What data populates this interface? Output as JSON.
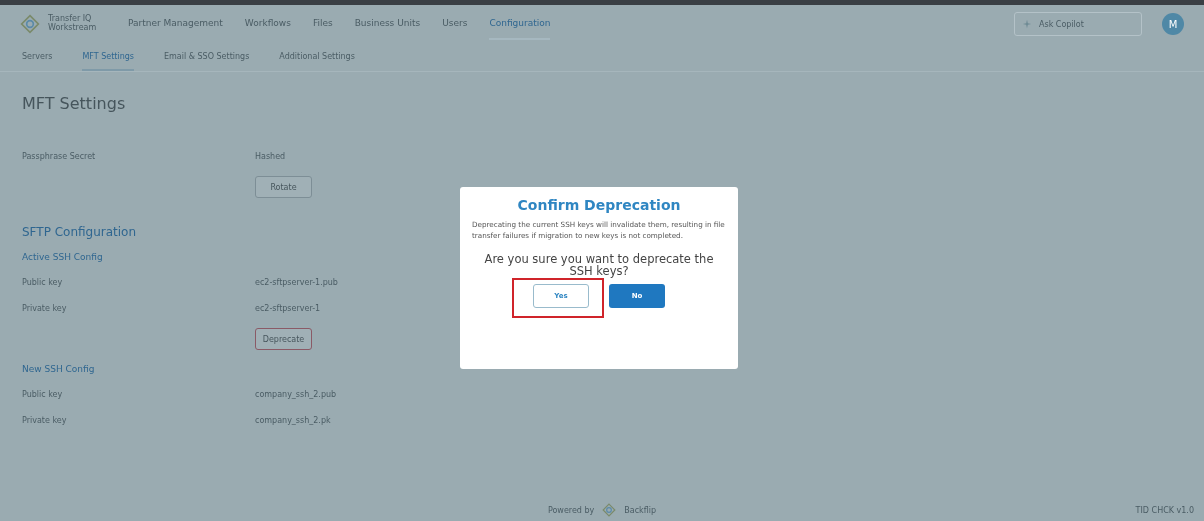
{
  "app": {
    "brand": "Transfer IQ Workstream"
  },
  "nav": [
    {
      "label": "Partner Management",
      "selected": false
    },
    {
      "label": "Workflows",
      "selected": false
    },
    {
      "label": "Files",
      "selected": false
    },
    {
      "label": "Business Units",
      "selected": false
    },
    {
      "label": "Users",
      "selected": false
    },
    {
      "label": "Configuration",
      "selected": true
    }
  ],
  "search": {
    "placeholder": "Ask Copilot"
  },
  "avatar": {
    "initial": "M"
  },
  "subtabs": [
    {
      "label": "Servers",
      "selected": false
    },
    {
      "label": "MFT Settings",
      "selected": true
    },
    {
      "label": "Email & SSO Settings",
      "selected": false
    },
    {
      "label": "Additional Settings",
      "selected": false
    }
  ],
  "page_title": "MFT Settings",
  "sections": [
    {
      "kind": "row",
      "label": "Passphrase Secret",
      "value": "Hashed"
    },
    {
      "kind": "button",
      "label": "Rotate",
      "danger": false
    },
    {
      "kind": "heading",
      "label": "SFTP Configuration"
    },
    {
      "kind": "subheading",
      "label": "Active SSH Config"
    },
    {
      "kind": "row",
      "label": "Public key",
      "value": "ec2-sftpserver-1.pub"
    },
    {
      "kind": "row",
      "label": "Private key",
      "value": "ec2-sftpserver-1"
    },
    {
      "kind": "button",
      "label": "Deprecate",
      "danger": true
    },
    {
      "kind": "subheading",
      "label": "New SSH Config"
    },
    {
      "kind": "row",
      "label": "Public key",
      "value": "company_ssh_2.pub"
    },
    {
      "kind": "row",
      "label": "Private key",
      "value": "company_ssh_2.pk"
    }
  ],
  "footer": {
    "powered_by": "Powered by",
    "vendor": "Backflip",
    "version": "TID CHCK v1.0"
  },
  "dialog": {
    "title": "Confirm Deprecation",
    "message": "Deprecating the current SSH keys will invalidate them, resulting in file transfer failures if migration to new keys is not completed.",
    "question": "Are you sure you want to deprecate the SSH keys?",
    "buttons": [
      {
        "label": "Yes",
        "kind": "secondary",
        "highlighted": true
      },
      {
        "label": "No",
        "kind": "primary",
        "highlighted": false
      }
    ]
  }
}
